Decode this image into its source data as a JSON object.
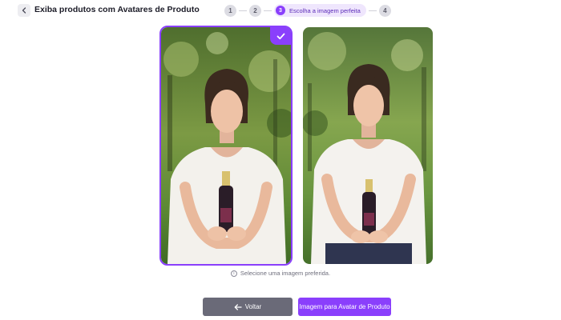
{
  "header": {
    "title": "Exiba produtos com Avatares de Produto",
    "back_icon": "chevron-left-icon"
  },
  "stepper": {
    "steps": [
      {
        "number": "1",
        "state": "inactive"
      },
      {
        "number": "2",
        "state": "inactive"
      },
      {
        "number": "3",
        "label": "Escolha a imagem perfeita",
        "state": "active"
      },
      {
        "number": "4",
        "state": "inactive"
      }
    ]
  },
  "images": [
    {
      "selected": true,
      "badge_icon": "checkmark-icon"
    },
    {
      "selected": false
    }
  ],
  "hint": {
    "icon": "info-icon",
    "text": "Selecione uma imagem preferida."
  },
  "footer": {
    "back_label": "Voltar",
    "back_icon": "arrow-left-icon",
    "next_label": "Imagem para Avatar de Produto"
  },
  "colors": {
    "accent": "#8a3ffc",
    "back_button": "#6a6a78"
  }
}
